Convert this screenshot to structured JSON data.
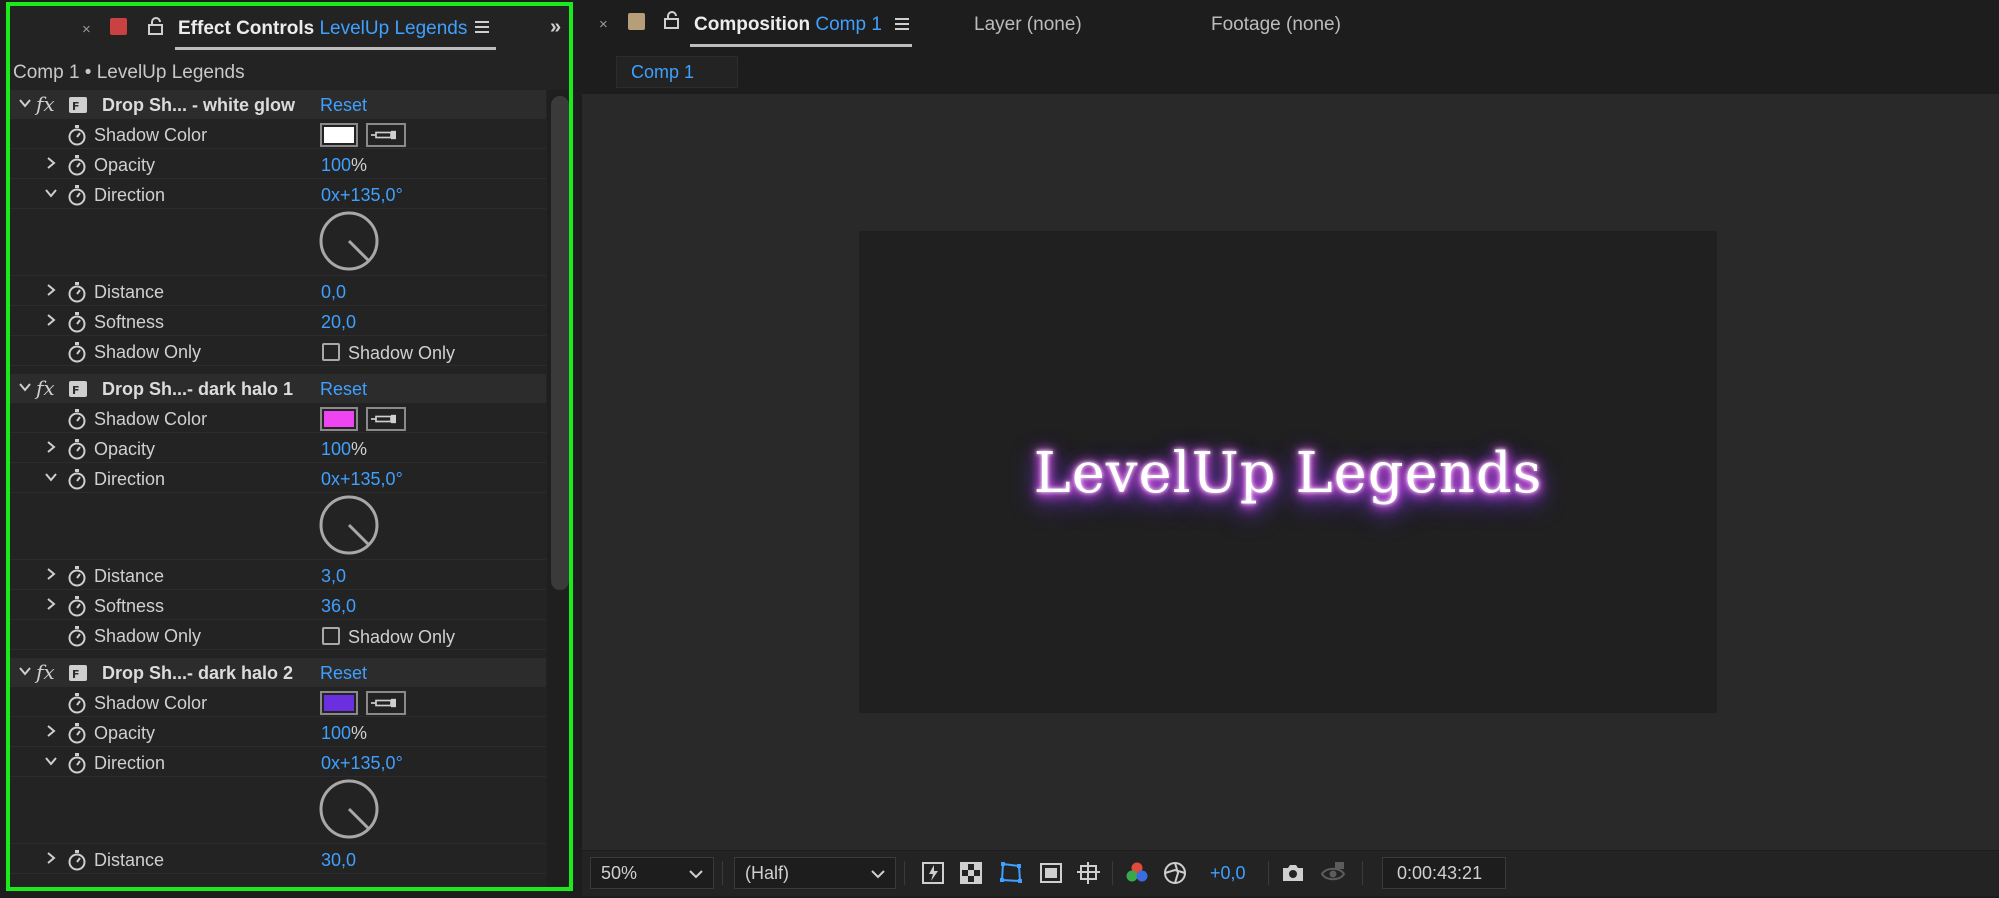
{
  "effect_controls": {
    "tab_label": "Effect Controls",
    "tab_layer": "LevelUp Legends",
    "header": "Comp 1 • LevelUp Legends",
    "effects": [
      {
        "name": "Drop Sh... - white glow",
        "reset": "Reset",
        "shadow_color_label": "Shadow Color",
        "shadow_color": "#ffffff",
        "opacity_label": "Opacity",
        "opacity": "100",
        "opacity_unit": "%",
        "direction_label": "Direction",
        "direction": "0x+135,0°",
        "distance_label": "Distance",
        "distance": "0,0",
        "softness_label": "Softness",
        "softness": "20,0",
        "shadow_only_label": "Shadow Only",
        "shadow_only_checkbox": "Shadow Only"
      },
      {
        "name": "Drop Sh...- dark halo 1",
        "reset": "Reset",
        "shadow_color_label": "Shadow Color",
        "shadow_color": "#ee44f2",
        "opacity_label": "Opacity",
        "opacity": "100",
        "opacity_unit": "%",
        "direction_label": "Direction",
        "direction": "0x+135,0°",
        "distance_label": "Distance",
        "distance": "3,0",
        "softness_label": "Softness",
        "softness": "36,0",
        "shadow_only_label": "Shadow Only",
        "shadow_only_checkbox": "Shadow Only"
      },
      {
        "name": "Drop Sh...- dark halo 2",
        "reset": "Reset",
        "shadow_color_label": "Shadow Color",
        "shadow_color": "#6a30df",
        "opacity_label": "Opacity",
        "opacity": "100",
        "opacity_unit": "%",
        "direction_label": "Direction",
        "direction": "0x+135,0°",
        "distance_label": "Distance",
        "distance": "30,0"
      }
    ]
  },
  "composition": {
    "tab_label": "Composition",
    "tab_comp": "Comp 1",
    "layer_tab": "Layer (none)",
    "footage_tab": "Footage (none)",
    "sub_tab": "Comp 1",
    "canvas_text": "LevelUp Legends",
    "glow_colors": [
      "#ffffff",
      "#f55bff",
      "#7a3fe8"
    ]
  },
  "viewer_toolbar": {
    "zoom": "50%",
    "resolution": "(Half)",
    "exposure": "+0,0",
    "timecode": "0:00:43:21"
  },
  "colors": {
    "accent": "#3fa0ff",
    "panel_highlight": "#1bea1b",
    "effect_controls_label": "#c94141",
    "composition_label": "#b59e78"
  }
}
